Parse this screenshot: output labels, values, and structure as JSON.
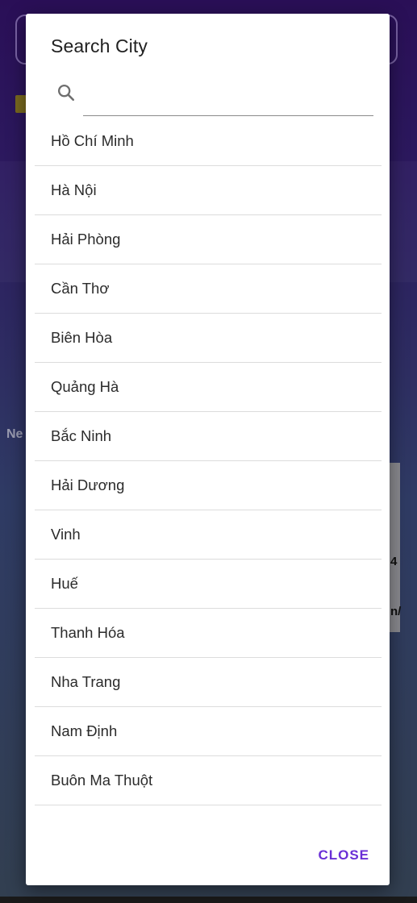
{
  "dialog": {
    "title": "Search City",
    "search": {
      "value": "",
      "placeholder": ""
    },
    "cities": [
      "Hồ Chí Minh",
      "Hà Nội",
      "Hải Phòng",
      "Cần Thơ",
      "Biên Hòa",
      "Quảng Hà",
      "Bắc Ninh",
      "Hải Dương",
      "Vinh",
      "Huế",
      "Thanh Hóa",
      "Nha Trang",
      "Nam Định",
      "Buôn Ma Thuột"
    ],
    "close_label": "CLOSE"
  },
  "background": {
    "partial_label_left": "Ne",
    "partial_label_right_1": "4",
    "partial_label_right_2": "n/"
  },
  "colors": {
    "accent": "#6a2fd6",
    "background_top": "#2a0f57",
    "background_bottom": "#323f50"
  },
  "icons": {
    "search": "search-icon"
  }
}
